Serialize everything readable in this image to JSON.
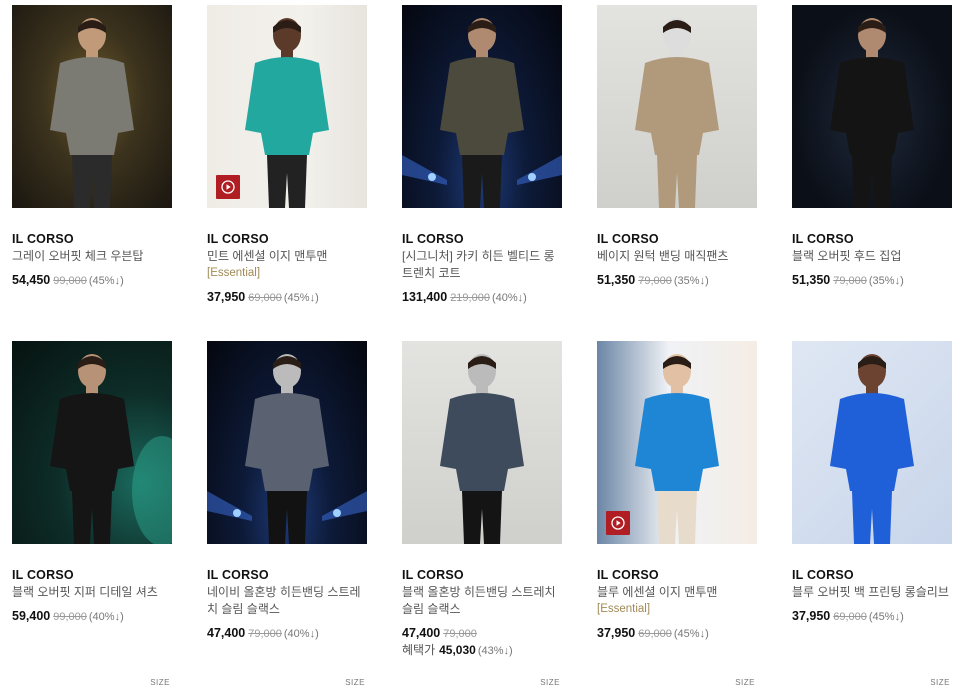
{
  "size_label": "SIZE",
  "products": [
    {
      "brand": "IL CORSO",
      "name_lines": [
        "그레이 오버핏 체크 우븐탑"
      ],
      "tag": "",
      "price": "54,450",
      "original": "99,000",
      "rate": "(45%↓)",
      "benefit_label": "",
      "benefit_price": "",
      "benefit_rate": "",
      "has_play": false,
      "img": "warm",
      "garment": "#7b7b74",
      "pants": "#2b2b2b",
      "skin": "#c19a7a"
    },
    {
      "brand": "IL CORSO",
      "name_lines": [
        "민트 에센셜 이지 맨투맨"
      ],
      "tag": "[Essential]",
      "price": "37,950",
      "original": "69,000",
      "rate": "(45%↓)",
      "benefit_label": "",
      "benefit_price": "",
      "benefit_rate": "",
      "has_play": true,
      "img": "light",
      "garment": "#23a8a0",
      "pants": "#222",
      "skin": "#5b3a2a"
    },
    {
      "brand": "IL CORSO",
      "name_lines": [
        "[시그니처] 카키 히든 벨티드 롱",
        "트렌치 코트"
      ],
      "tag": "",
      "price": "131,400",
      "original": "219,000",
      "rate": "(40%↓)",
      "benefit_label": "",
      "benefit_price": "",
      "benefit_rate": "",
      "has_play": false,
      "img": "stage",
      "garment": "#4b4a3d",
      "pants": "#1a1a1a",
      "skin": "#b08a70"
    },
    {
      "brand": "IL CORSO",
      "name_lines": [
        "베이지 원턱 밴딩 매직팬츠"
      ],
      "tag": "",
      "price": "51,350",
      "original": "79,000",
      "rate": "(35%↓)",
      "benefit_label": "",
      "benefit_price": "",
      "benefit_rate": "",
      "has_play": false,
      "img": "studio",
      "garment": "#b19a7c",
      "pants": "#b19a7c",
      "skin": "#ddd"
    },
    {
      "brand": "IL CORSO",
      "name_lines": [
        "블랙 오버핏 후드 집업"
      ],
      "tag": "",
      "price": "51,350",
      "original": "79,000",
      "rate": "(35%↓)",
      "benefit_label": "",
      "benefit_price": "",
      "benefit_rate": "",
      "has_play": false,
      "img": "dark",
      "garment": "#141414",
      "pants": "#141414",
      "skin": "#b08a70"
    },
    {
      "brand": "IL CORSO",
      "name_lines": [
        "블랙 오버핏 지퍼 디테일 셔츠"
      ],
      "tag": "",
      "price": "59,400",
      "original": "99,000",
      "rate": "(40%↓)",
      "benefit_label": "",
      "benefit_price": "",
      "benefit_rate": "",
      "has_play": false,
      "img": "teal",
      "garment": "#151515",
      "pants": "#151515",
      "skin": "#b89276"
    },
    {
      "brand": "IL CORSO",
      "name_lines": [
        "네이비 올혼방 히든밴딩 스트레",
        "치 슬림 슬랙스"
      ],
      "tag": "",
      "price": "47,400",
      "original": "79,000",
      "rate": "(40%↓)",
      "benefit_label": "",
      "benefit_price": "",
      "benefit_rate": "",
      "has_play": false,
      "img": "stage",
      "garment": "#5a6170",
      "pants": "#121212",
      "skin": "#bbb"
    },
    {
      "brand": "IL CORSO",
      "name_lines": [
        "블랙 올혼방 히든밴딩 스트레치",
        "슬림 슬랙스"
      ],
      "tag": "",
      "price": "47,400",
      "original": "79,000",
      "rate": "",
      "benefit_label": "혜택가",
      "benefit_price": "45,030",
      "benefit_rate": "(43%↓)",
      "has_play": false,
      "img": "studio",
      "garment": "#3e4b5c",
      "pants": "#141414",
      "skin": "#bbb"
    },
    {
      "brand": "IL CORSO",
      "name_lines": [
        "블루 에센셜 이지 맨투맨"
      ],
      "tag": "[Essential]",
      "price": "37,950",
      "original": "69,000",
      "rate": "(45%↓)",
      "benefit_label": "",
      "benefit_price": "",
      "benefit_rate": "",
      "has_play": true,
      "img": "blue",
      "garment": "#1f86d6",
      "pants": "#e7dccb",
      "skin": "#e2c0a4"
    },
    {
      "brand": "IL CORSO",
      "name_lines": [
        "블루 오버핏 백 프린팅 롱슬리브"
      ],
      "tag": "",
      "price": "37,950",
      "original": "69,000",
      "rate": "(45%↓)",
      "benefit_label": "",
      "benefit_price": "",
      "benefit_rate": "",
      "has_play": false,
      "img": "blue2",
      "garment": "#1f5fd8",
      "pants": "#1f5fd8",
      "skin": "#6b4330"
    }
  ]
}
